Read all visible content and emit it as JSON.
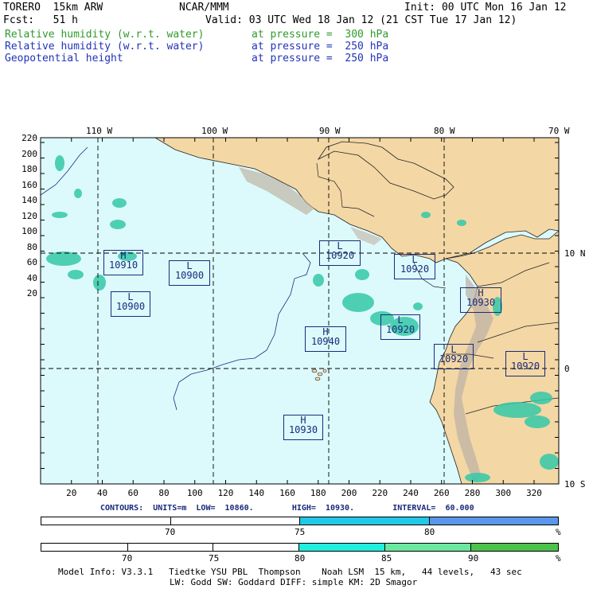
{
  "header": {
    "model": "TORERO  15km ARW",
    "center": "NCAR/MMM",
    "init": "Init: 00 UTC Mon 16 Jan 12",
    "fcst": "Fcst:   51 h",
    "valid": "Valid: 03 UTC Wed 18 Jan 12 (21 CST Tue 17 Jan 12)",
    "fields": [
      {
        "name": "Relative humidity (w.r.t. water)",
        "level": "at pressure =  300 hPa",
        "color": "#2e9a2e"
      },
      {
        "name": "Relative humidity (w.r.t. water)",
        "level": "at pressure =  250 hPa",
        "color": "#2233bb"
      },
      {
        "name": "Geopotential height",
        "level": "at pressure =  250 hPa",
        "color": "#2233bb"
      }
    ]
  },
  "map": {
    "top_lon_labels": [
      "110 W",
      "100 W",
      "90 W",
      "80 W",
      "70 W"
    ],
    "right_lat_labels": [
      "10 N",
      "0",
      "10 S"
    ],
    "y_ticks": [
      "220",
      "200",
      "180",
      "160",
      "140",
      "120",
      "100",
      "80",
      "60",
      "40",
      "20"
    ],
    "x_ticks": [
      "20",
      "40",
      "60",
      "80",
      "100",
      "120",
      "140",
      "160",
      "180",
      "200",
      "220",
      "240",
      "260",
      "280",
      "300",
      "320"
    ],
    "ocean_color": "#dcfafc",
    "land_color": "#f3d7a5",
    "centers": [
      {
        "type": "H",
        "value": "10910"
      },
      {
        "type": "L",
        "value": "10900"
      },
      {
        "type": "L",
        "value": "10900"
      },
      {
        "type": "L",
        "value": "10920"
      },
      {
        "type": "L",
        "value": "10920"
      },
      {
        "type": "H",
        "value": "10930"
      },
      {
        "type": "H",
        "value": "10940"
      },
      {
        "type": "L",
        "value": "10920"
      },
      {
        "type": "L",
        "value": "10920"
      },
      {
        "type": "L",
        "value": "10920"
      },
      {
        "type": "H",
        "value": "10930"
      }
    ]
  },
  "contours": {
    "text": "CONTOURS:  UNITS=m  LOW=  10860.        HIGH=  10930.        INTERVAL=  60.000"
  },
  "colorbar_250": {
    "labels": [
      "70",
      "75",
      "80",
      "%"
    ],
    "colors": [
      "#ffffff",
      "#ffffff",
      "#22c8e8",
      "#5a96ea"
    ]
  },
  "colorbar_300": {
    "labels": [
      "70",
      "75",
      "80",
      "85",
      "90",
      "%"
    ],
    "colors": [
      "#ffffff",
      "#ffffff",
      "#ffffff",
      "#22eedd",
      "#6ae8a0",
      "#4cc24c",
      "#229922"
    ]
  },
  "footer": {
    "line1": "Model Info: V3.3.1   Tiedtke YSU PBL  Thompson    Noah LSM  15 km,   44 levels,   43 sec",
    "line2": "LW: Godd SW: Goddard DIFF: simple KM: 2D Smagor"
  }
}
